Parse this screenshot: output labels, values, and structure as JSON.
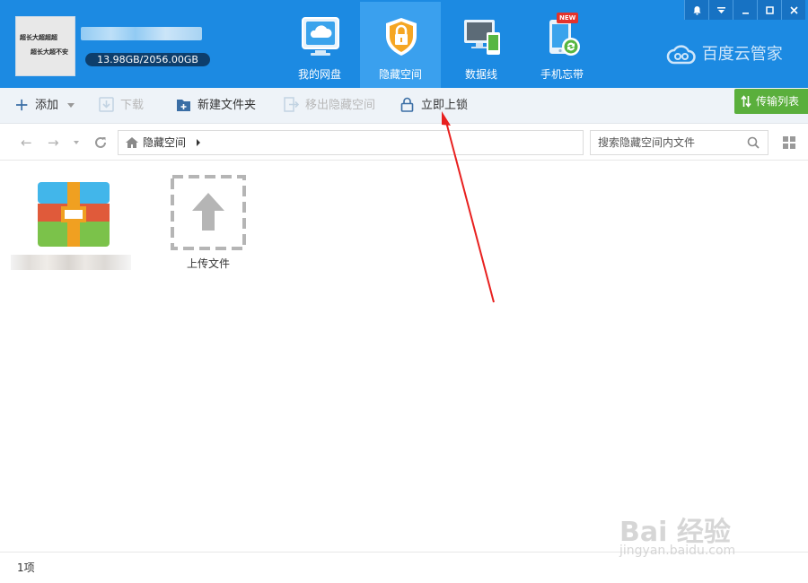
{
  "header": {
    "avatar_lines": [
      "超长大超超超",
      "超长大超不安"
    ],
    "quota": "13.98GB/2056.00GB",
    "tabs": [
      {
        "label": "我的网盘",
        "icon": "cloud-drive-icon"
      },
      {
        "label": "隐藏空间",
        "icon": "lock-shield-icon",
        "active": true
      },
      {
        "label": "数据线",
        "icon": "devices-icon"
      },
      {
        "label": "手机忘带",
        "icon": "phone-sync-icon"
      }
    ],
    "new_badge": "NEW",
    "brand": "百度云管家"
  },
  "toolbar": {
    "add": "添加",
    "download": "下载",
    "new_folder": "新建文件夹",
    "move_out": "移出隐藏空间",
    "lock_now": "立即上锁",
    "transfer_list": "传输列表"
  },
  "addressbar": {
    "crumb": "隐藏空间",
    "search_placeholder": "搜索隐藏空间内文件"
  },
  "content": {
    "upload_label": "上传文件"
  },
  "statusbar": {
    "count": "1项"
  },
  "watermark": {
    "main": "Bai 经验",
    "sub": "jingyan.baidu.com"
  },
  "colors": {
    "header_bg": "#1c8ae2",
    "active_tab": "#3aa0ee",
    "transfer_btn": "#5aaf3c",
    "annotation_arrow": "#e8201f"
  }
}
